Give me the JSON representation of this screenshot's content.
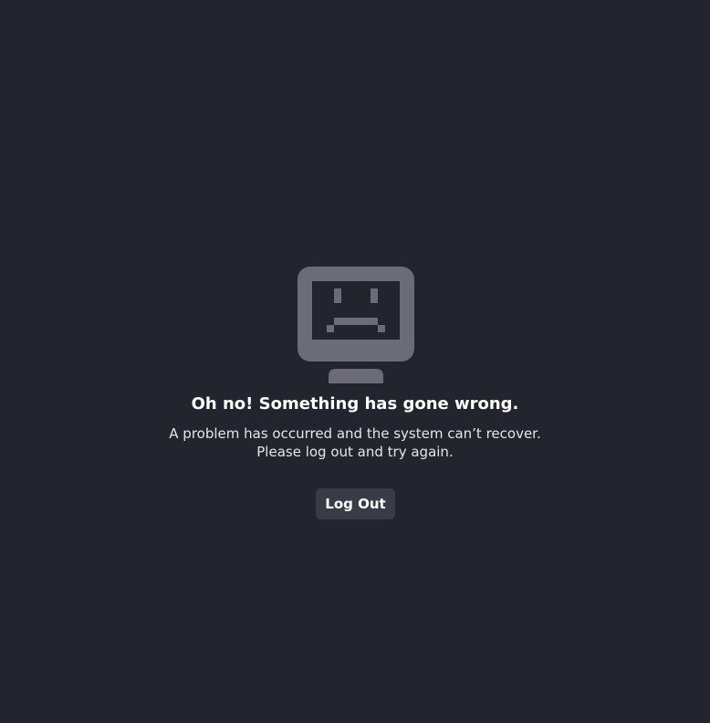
{
  "error_dialog": {
    "icon": "sad-computer-icon",
    "title": "Oh no!  Something has gone wrong.",
    "message_line1": "A problem has occurred and the system can’t recover.",
    "message_line2": "Please log out and try again.",
    "logout_label": "Log Out"
  },
  "colors": {
    "background": "#23252e",
    "icon": "#6b6c78",
    "button": "#3a3c45",
    "text": "#ffffff"
  }
}
